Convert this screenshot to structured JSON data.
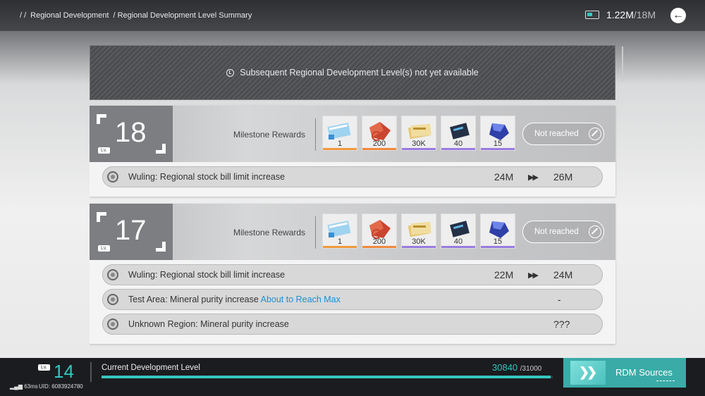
{
  "breadcrumb": {
    "sep": "/ /",
    "items": [
      "Regional Development",
      "/ Regional Development Level Summary"
    ]
  },
  "stock": {
    "current": "1.22M",
    "max": "/18M",
    "icon": "stock-bill-icon"
  },
  "notice": {
    "text": "Subsequent Regional Development Level(s) not yet available",
    "icon": "clock-icon"
  },
  "levels": [
    {
      "lv_tag": "Lv.",
      "level": "18",
      "milestone_label": "Milestone Rewards",
      "rewards": [
        {
          "qty": "1",
          "rarity": "orange"
        },
        {
          "qty": "200",
          "rarity": "red"
        },
        {
          "qty": "30K",
          "rarity": "purple"
        },
        {
          "qty": "40",
          "rarity": "purple"
        },
        {
          "qty": "15",
          "rarity": "purple"
        }
      ],
      "status": "Not reached",
      "effects": [
        {
          "text": "Wuling: Regional stock bill limit increase",
          "from": "24M",
          "to": "26M"
        }
      ]
    },
    {
      "lv_tag": "Lv.",
      "level": "17",
      "milestone_label": "Milestone Rewards",
      "rewards": [
        {
          "qty": "1",
          "rarity": "orange"
        },
        {
          "qty": "200",
          "rarity": "red"
        },
        {
          "qty": "30K",
          "rarity": "purple"
        },
        {
          "qty": "40",
          "rarity": "purple"
        },
        {
          "qty": "15",
          "rarity": "purple"
        }
      ],
      "status": "Not reached",
      "effects": [
        {
          "text": "Wuling: Regional stock bill limit increase",
          "from": "22M",
          "to": "24M"
        },
        {
          "text": "Test Area: Mineral purity increase",
          "highlight": "About to Reach Max",
          "value": "-"
        },
        {
          "text": "Unknown Region: Mineral purity increase",
          "value": "???"
        }
      ]
    }
  ],
  "bottom": {
    "lv_tag": "Lv.",
    "level": "14",
    "ping": "63ms",
    "uid": "UID: 6083924780",
    "label": "Current Development Level",
    "progress_current": "30840",
    "progress_max": "/31000",
    "progress_fraction": 0.995,
    "rdm_label": "RDM Sources"
  },
  "colors": {
    "accent": "#35c6c0",
    "highlight": "#1b8fd4",
    "rdm_button": "#3aaba7"
  }
}
